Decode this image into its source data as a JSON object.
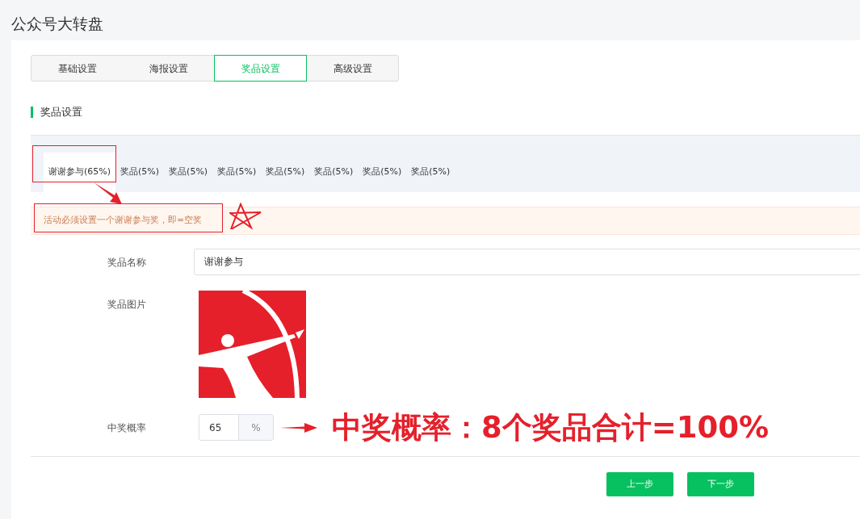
{
  "page_title": "公众号大转盘",
  "tabs": [
    {
      "label": "基础设置",
      "selected": false
    },
    {
      "label": "海报设置",
      "selected": false
    },
    {
      "label": "奖品设置",
      "selected": true
    },
    {
      "label": "高级设置",
      "selected": false
    }
  ],
  "section_title": "奖品设置",
  "prize_tabs": [
    {
      "label": "谢谢参与(65%)",
      "selected": true
    },
    {
      "label": "奖品(5%)",
      "selected": false
    },
    {
      "label": "奖品(5%)",
      "selected": false
    },
    {
      "label": "奖品(5%)",
      "selected": false
    },
    {
      "label": "奖品(5%)",
      "selected": false
    },
    {
      "label": "奖品(5%)",
      "selected": false
    },
    {
      "label": "奖品(5%)",
      "selected": false
    },
    {
      "label": "奖品(5%)",
      "selected": false
    }
  ],
  "notice": "活动必须设置一个谢谢参与奖，即=空奖",
  "form": {
    "name_label": "奖品名称",
    "name_value": "谢谢参与",
    "image_label": "奖品图片",
    "probability_label": "中奖概率",
    "probability_value": "65",
    "probability_unit": "%"
  },
  "annotation": "中奖概率：8个奖品合计=100%",
  "buttons": [
    "上一步",
    "下一步"
  ]
}
